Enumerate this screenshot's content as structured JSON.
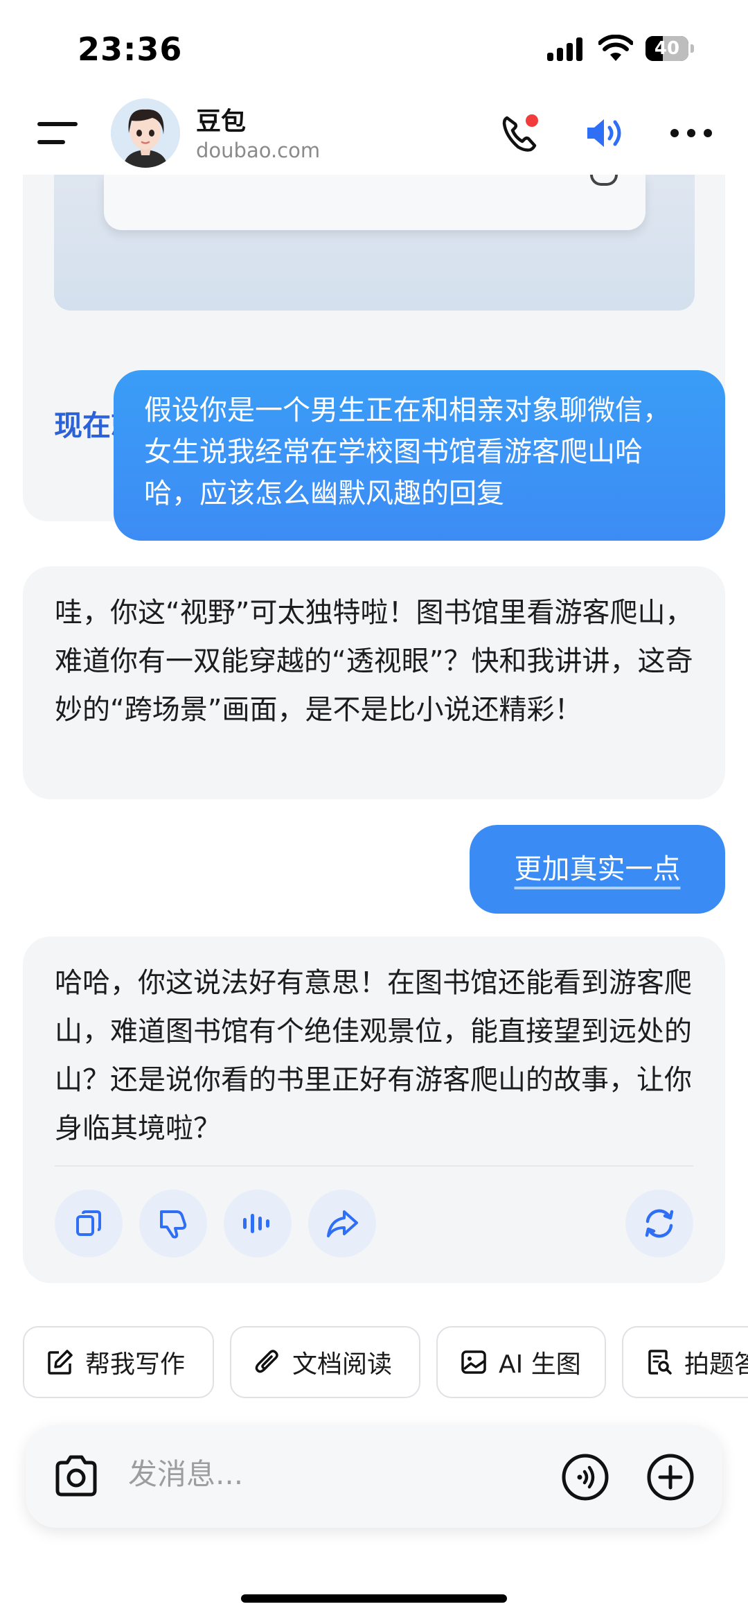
{
  "status_bar": {
    "time": "23:36",
    "battery": "40"
  },
  "header": {
    "title": "豆包",
    "subtitle": "doubao.com",
    "icons": [
      "menu-icon",
      "phone-icon",
      "speaker-icon",
      "more-icon"
    ],
    "phone_badge_color": "#f23c3c",
    "speaker_color": "#2f6ff5"
  },
  "chat": {
    "previous_card": {
      "link_label": "现在就体验 →"
    },
    "messages": [
      {
        "role": "user",
        "text": "假设你是一个男生正在和相亲对象聊微信，女生说我经常在学校图书馆看游客爬山哈哈，应该怎么幽默风趣的回复"
      },
      {
        "role": "assistant",
        "text": "哇，你这“视野”可太独特啦！图书馆里看游客爬山，难道你有一双能穿越的“透视眼”？快和我讲讲，这奇妙的“跨场景”画面，是不是比小说还精彩！"
      },
      {
        "role": "user",
        "text": "更加真实一点"
      },
      {
        "role": "assistant",
        "text": "哈哈，你这说法好有意思！在图书馆还能看到游客爬山，难道图书馆有个绝佳观景位，能直接望到远处的山？还是说你看的书里正好有游客爬山的故事，让你身临其境啦？"
      }
    ],
    "message_actions": [
      "copy-icon",
      "dislike-icon",
      "voice-play-icon",
      "share-icon",
      "regenerate-icon"
    ]
  },
  "suggestions": [
    {
      "label": "帮我写作",
      "icon": "edit-icon"
    },
    {
      "label": "文档阅读",
      "icon": "paperclip-icon"
    },
    {
      "label": "AI 生图",
      "icon": "image-icon"
    },
    {
      "label": "拍题答",
      "icon": "search-doc-icon"
    }
  ],
  "input": {
    "placeholder": "发消息..."
  },
  "colors": {
    "user_bubble": "#3d8cf5",
    "ai_bubble": "#f4f5f7",
    "accent": "#2c62d8"
  }
}
